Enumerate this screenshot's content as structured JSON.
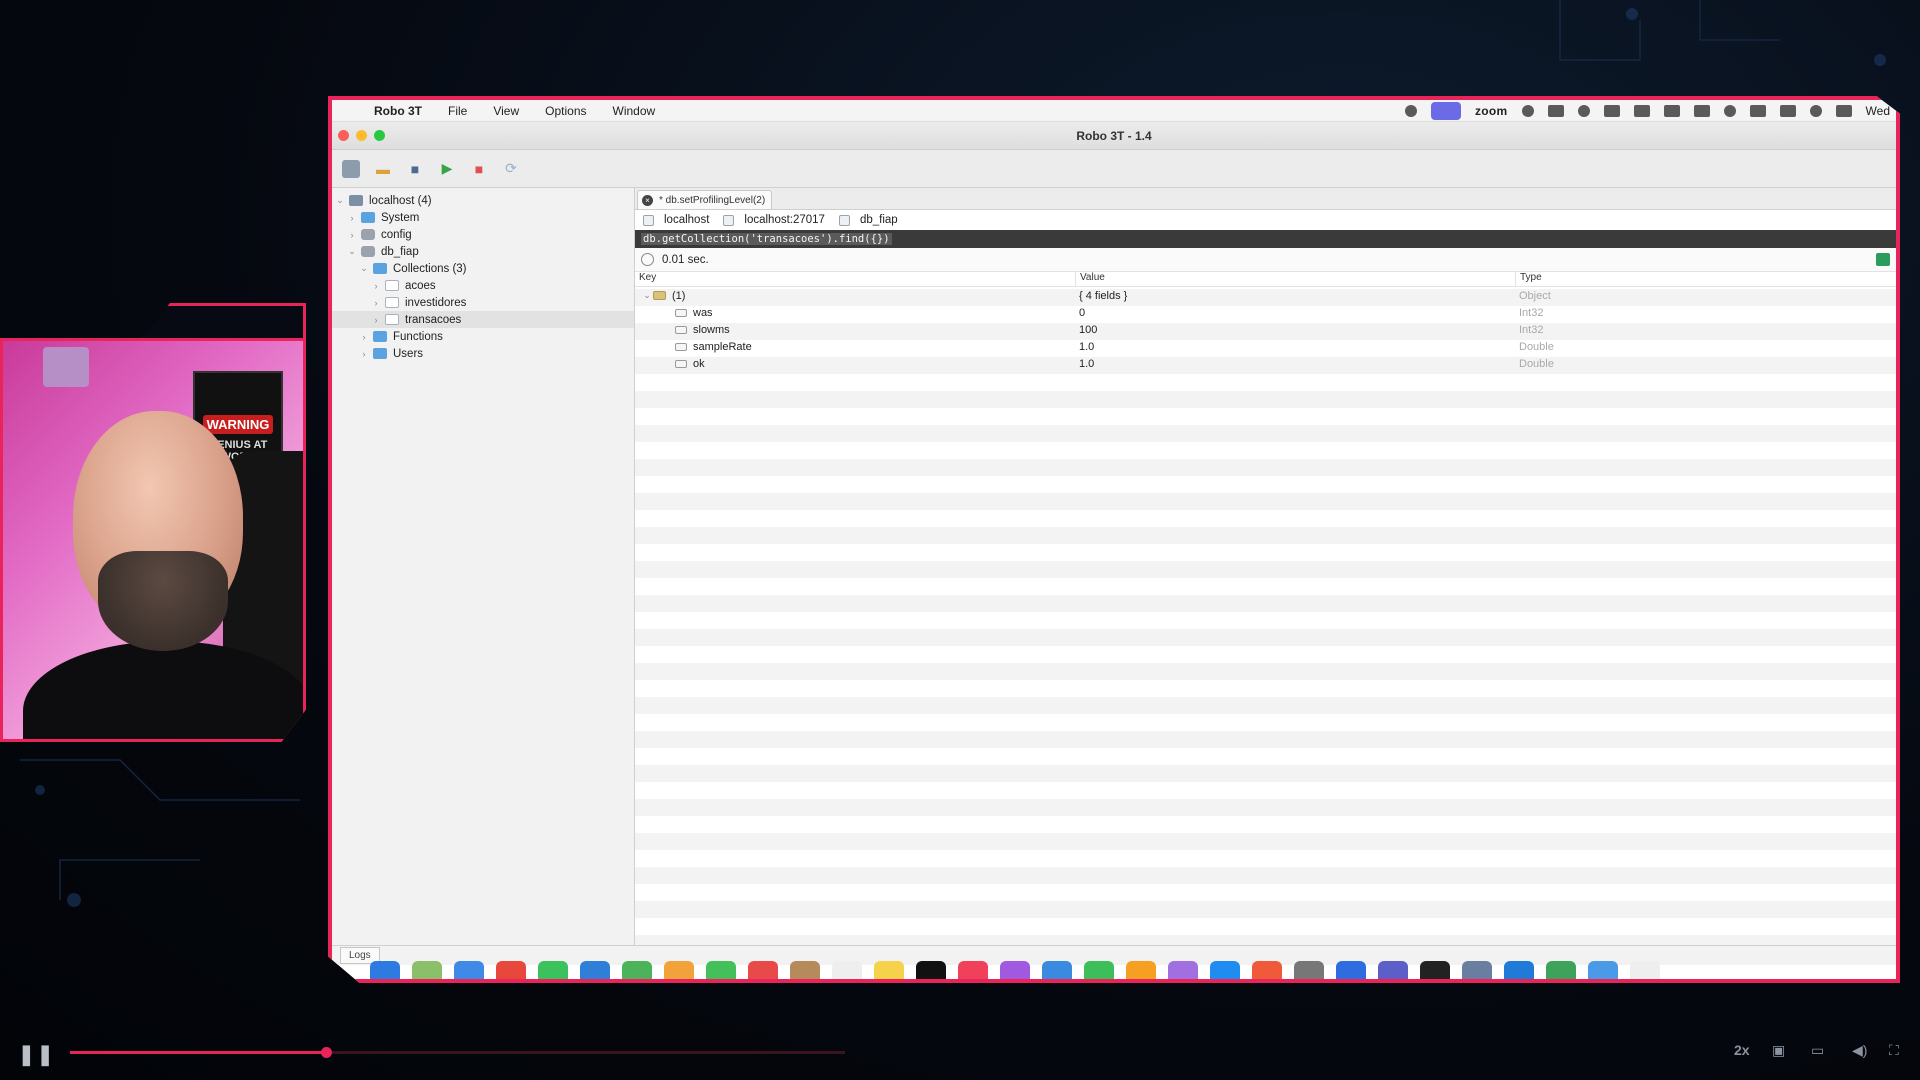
{
  "menubar": {
    "apple": "",
    "app": "Robo 3T",
    "items": [
      "File",
      "View",
      "Options",
      "Window"
    ],
    "zoom": "zoom",
    "clock": "Wed"
  },
  "window": {
    "title": "Robo 3T - 1.4"
  },
  "sidebar": {
    "root": {
      "label": "localhost (4)",
      "icon": "server-icon"
    },
    "items": [
      {
        "label": "System",
        "icon": "folder-icon"
      },
      {
        "label": "config",
        "icon": "database-icon"
      },
      {
        "label": "db_fiap",
        "icon": "database-icon"
      },
      {
        "label": "Collections (3)",
        "icon": "folder-icon"
      },
      {
        "label": "acoes",
        "icon": "collection-icon"
      },
      {
        "label": "investidores",
        "icon": "collection-icon"
      },
      {
        "label": "transacoes",
        "icon": "collection-icon"
      },
      {
        "label": "Functions",
        "icon": "folder-icon"
      },
      {
        "label": "Users",
        "icon": "folder-icon"
      }
    ]
  },
  "tab": {
    "label": "* db.setProfilingLevel(2)"
  },
  "conninfo": {
    "host": "localhost",
    "port": "localhost:27017",
    "db": "db_fiap"
  },
  "query": "db.getCollection('transacoes').find({})",
  "timing": "0.01 sec.",
  "results": {
    "headers": {
      "key": "Key",
      "value": "Value",
      "type": "Type"
    },
    "rows": [
      {
        "key": "(1)",
        "value": "{ 4 fields }",
        "type": "Object"
      },
      {
        "key": "was",
        "value": "0",
        "type": "Int32"
      },
      {
        "key": "slowms",
        "value": "100",
        "type": "Int32"
      },
      {
        "key": "sampleRate",
        "value": "1.0",
        "type": "Double"
      },
      {
        "key": "ok",
        "value": "1.0",
        "type": "Double"
      }
    ]
  },
  "logs": "Logs",
  "cam": {
    "warning": "WARNING",
    "genius": "GENIUS AT WORK"
  },
  "player": {
    "speed": "2x",
    "progress": 0.33
  },
  "colors": {
    "accent": "#e8245b",
    "query_bg": "#3a3a3a"
  }
}
